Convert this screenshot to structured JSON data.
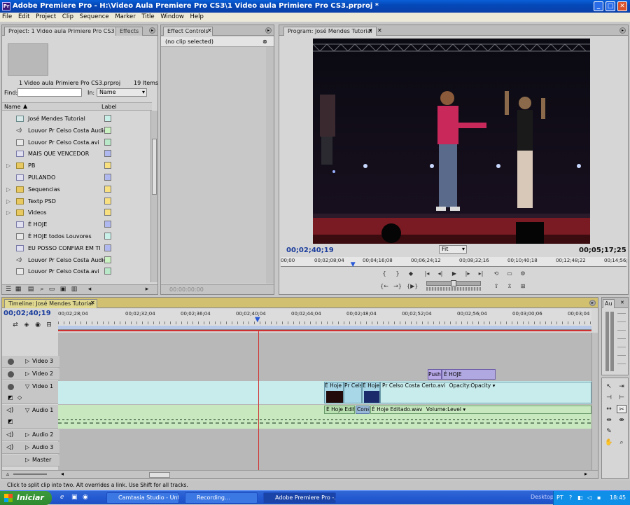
{
  "window": {
    "title": "Adobe Premiere Pro - H:\\Video Aula Premiere Pro CS3\\1 Video aula Primiere Pro CS3.prproj *",
    "minimize": "_",
    "maximize": "□",
    "close": "✕"
  },
  "menu": [
    "File",
    "Edit",
    "Project",
    "Clip",
    "Sequence",
    "Marker",
    "Title",
    "Window",
    "Help"
  ],
  "project": {
    "tab_label": "Project: 1 Video aula Primiere Pro CS3",
    "effects_tab": "Effects",
    "file_name": "1 Video aula Primiere Pro CS3.prproj",
    "items_count": "19 Items",
    "find_label": "Find:",
    "in_label": "In:",
    "in_value": "Name",
    "col_name": "Name",
    "col_label": "Label",
    "items": [
      {
        "name": "José Mendes  Tutorial",
        "icon": "sequence-icon",
        "color": "#c8f0e8",
        "expand": ""
      },
      {
        "name": "Louvor Pr Celso Costa Audio",
        "icon": "audio-icon",
        "color": "#c8f0c0",
        "expand": ""
      },
      {
        "name": "Louvor Pr Celso Costa.avi",
        "icon": "video-clip-icon",
        "color": "#b8e8c8",
        "expand": ""
      },
      {
        "name": "MAIS QUE VENCEDOR",
        "icon": "title-icon",
        "color": "#b0b8f0",
        "expand": ""
      },
      {
        "name": "PB",
        "icon": "bin-icon",
        "color": "#f8e080",
        "expand": "▷"
      },
      {
        "name": "PULANDO",
        "icon": "title-icon",
        "color": "#b0b8f0",
        "expand": ""
      },
      {
        "name": "Sequencias",
        "icon": "bin-icon",
        "color": "#f8e080",
        "expand": "▷"
      },
      {
        "name": "Textp PSD",
        "icon": "bin-icon",
        "color": "#f8e080",
        "expand": "▷"
      },
      {
        "name": "Videos",
        "icon": "bin-icon",
        "color": "#f8e080",
        "expand": "▷"
      },
      {
        "name": "É HOJE",
        "icon": "title-icon",
        "color": "#b0b8f0",
        "expand": ""
      },
      {
        "name": "É HOJE todos Louvores",
        "icon": "video-clip-icon",
        "color": "#c8f0e8",
        "expand": ""
      },
      {
        "name": "EU POSSO CONFIAR EM TI",
        "icon": "title-icon",
        "color": "#b0b8f0",
        "expand": ""
      },
      {
        "name": "Louvor Pr Celso Costa Audio",
        "icon": "audio-icon",
        "color": "#c8f0c0",
        "expand": ""
      },
      {
        "name": "Louvor Pr Celso Costa.avi",
        "icon": "video-clip-icon",
        "color": "#b8e8c8",
        "expand": ""
      }
    ]
  },
  "effect_controls": {
    "tab_label": "Effect Controls",
    "no_clip": "(no clip selected)",
    "bottom_tc": "00:00:00:00"
  },
  "program": {
    "tab_label": "Program: José Mendes  Tutorial",
    "current_tc": "00;02;40;19",
    "fit": "Fit",
    "duration_tc": "00;05;17;25",
    "ruler_ticks": [
      "00;00",
      "00;02;08;04",
      "00;04;16;08",
      "00;06;24;12",
      "00;08;32;16",
      "00;10;40;18",
      "00;12;48;22",
      "00;14;56;"
    ],
    "playhead_fraction": 0.21
  },
  "timeline": {
    "tab_label": "Timeline: José Mendes  Tutorial",
    "current_tc": "00;02;40;19",
    "ruler_ticks": [
      "00;02;28;04",
      "00;02;32;04",
      "00;02;36;04",
      "00;02;40;04",
      "00;02;44;04",
      "00;02;48;04",
      "00;02;52;04",
      "00;02;56;04",
      "00;03;00;06",
      "00;03;04"
    ],
    "tracks": [
      "Video 3",
      "Video 2",
      "Video 1",
      "Audio 1",
      "Audio 2",
      "Audio 3",
      "Master"
    ],
    "clips": {
      "v2_push": "Push",
      "v2_title": "É HOJE",
      "v1_a": "É Hoje",
      "v1_b": "Pr Cels",
      "v1_c": "É Hoje",
      "v1_d": "Pr Celso Costa Certo.avi",
      "v1_opacity": "Opacity:Opacity ▾",
      "a1_a": "É Hoje Edita",
      "a1_b": "Cons",
      "a1_c": "É Hoje Editado.wav",
      "a1_volume": "Volume:Level ▾"
    }
  },
  "audio_panel": {
    "tab_label": "Au"
  },
  "status": "Click to split clip into two. Alt overrides a link. Use Shift for all tracks.",
  "taskbar": {
    "start": "Iniciar",
    "items": [
      "Camtasia Studio - Unt...",
      "Recording...",
      "Adobe Premiere Pro -..."
    ],
    "desktop": "Desktop",
    "lang": "PT",
    "clock": "18:45"
  }
}
